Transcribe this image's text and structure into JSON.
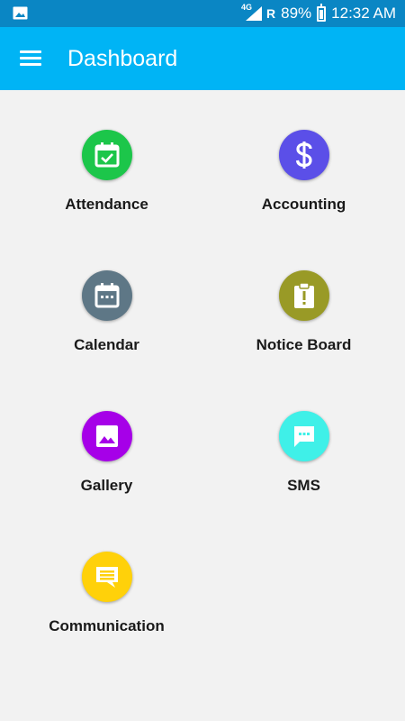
{
  "status_bar": {
    "network": "4G",
    "roaming": "R",
    "battery": "89%",
    "time": "12:32 AM"
  },
  "app_bar": {
    "title": "Dashboard"
  },
  "tiles": [
    {
      "label": "Attendance",
      "icon": "calendar-check-icon",
      "color": "#1cc64a"
    },
    {
      "label": "Accounting",
      "icon": "dollar-icon",
      "color": "#5b4fe8"
    },
    {
      "label": "Calendar",
      "icon": "calendar-icon",
      "color": "#5e7786"
    },
    {
      "label": "Notice Board",
      "icon": "notice-board-icon",
      "color": "#999a26"
    },
    {
      "label": "Gallery",
      "icon": "image-icon",
      "color": "#a600e8"
    },
    {
      "label": "SMS",
      "icon": "sms-icon",
      "color": "#3ff0e8"
    },
    {
      "label": "Communication",
      "icon": "message-icon",
      "color": "#ffd10a"
    }
  ]
}
